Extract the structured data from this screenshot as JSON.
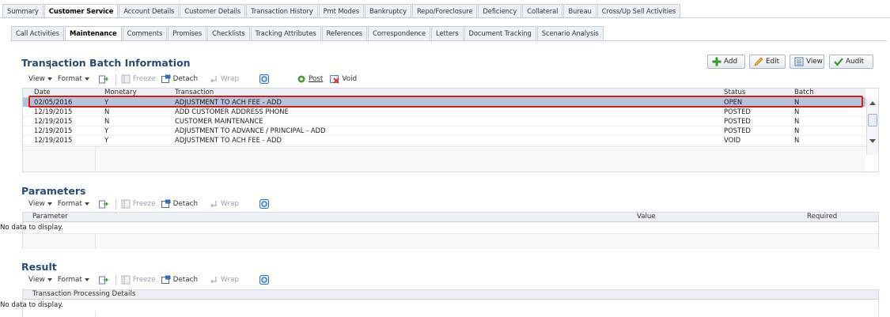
{
  "top_tabs": [
    {
      "label": "Summary",
      "active": false
    },
    {
      "label": "Customer Service",
      "active": true
    },
    {
      "label": "Account Details",
      "active": false
    },
    {
      "label": "Customer Details",
      "active": false
    },
    {
      "label": "Transaction History",
      "active": false
    },
    {
      "label": "Pmt Modes",
      "active": false
    },
    {
      "label": "Bankruptcy",
      "active": false
    },
    {
      "label": "Repo/Foreclosure",
      "active": false
    },
    {
      "label": "Deficiency",
      "active": false
    },
    {
      "label": "Collateral",
      "active": false
    },
    {
      "label": "Bureau",
      "active": false
    },
    {
      "label": "Cross/Up Sell Activities",
      "active": false
    }
  ],
  "sub_tabs": [
    {
      "label": "Call Activities",
      "active": false
    },
    {
      "label": "Maintenance",
      "active": true
    },
    {
      "label": "Comments",
      "active": false
    },
    {
      "label": "Promises",
      "active": false
    },
    {
      "label": "Checklists",
      "active": false
    },
    {
      "label": "Tracking Attributes",
      "active": false
    },
    {
      "label": "References",
      "active": false
    },
    {
      "label": "Correspondence",
      "active": false
    },
    {
      "label": "Letters",
      "active": false
    },
    {
      "label": "Document Tracking",
      "active": false
    },
    {
      "label": "Scenario Analysis",
      "active": false
    }
  ],
  "toolbar": {
    "view": "View",
    "format": "Format",
    "freeze": "Freeze",
    "detach": "Detach",
    "wrap": "Wrap",
    "post": "Post",
    "void": "Void"
  },
  "actions": {
    "add": "Add",
    "edit": "Edit",
    "view": "View",
    "audit": "Audit"
  },
  "batch": {
    "title": "Transaction Batch Information",
    "columns": {
      "date": "Date",
      "monetary": "Monetary",
      "transaction": "Transaction",
      "status": "Status",
      "batch": "Batch"
    },
    "rows": [
      {
        "date": "02/05/2016",
        "monetary": "Y",
        "transaction": "ADJUSTMENT TO ACH FEE - ADD",
        "status": "OPEN",
        "batch": "N",
        "selected": true
      },
      {
        "date": "12/19/2015",
        "monetary": "N",
        "transaction": "ADD CUSTOMER ADDRESS PHONE",
        "status": "POSTED",
        "batch": "N",
        "selected": false
      },
      {
        "date": "12/19/2015",
        "monetary": "N",
        "transaction": "CUSTOMER MAINTENANCE",
        "status": "POSTED",
        "batch": "N",
        "selected": false
      },
      {
        "date": "12/19/2015",
        "monetary": "Y",
        "transaction": "ADJUSTMENT TO ADVANCE / PRINCIPAL - ADD",
        "status": "POSTED",
        "batch": "N",
        "selected": false
      },
      {
        "date": "12/19/2015",
        "monetary": "Y",
        "transaction": "ADJUSTMENT TO ACH FEE - ADD",
        "status": "VOID",
        "batch": "N",
        "selected": false
      }
    ]
  },
  "parameters": {
    "title": "Parameters",
    "columns": {
      "parameter": "Parameter",
      "value": "Value",
      "required": "Required"
    },
    "empty": "No data to display."
  },
  "result": {
    "title": "Result",
    "columns": {
      "details": "Transaction Processing Details"
    },
    "empty": "No data to display."
  },
  "colors": {
    "section_title": "#2a4a74",
    "selected_row": "#b2c3da",
    "highlight_border": "#d7191c"
  }
}
